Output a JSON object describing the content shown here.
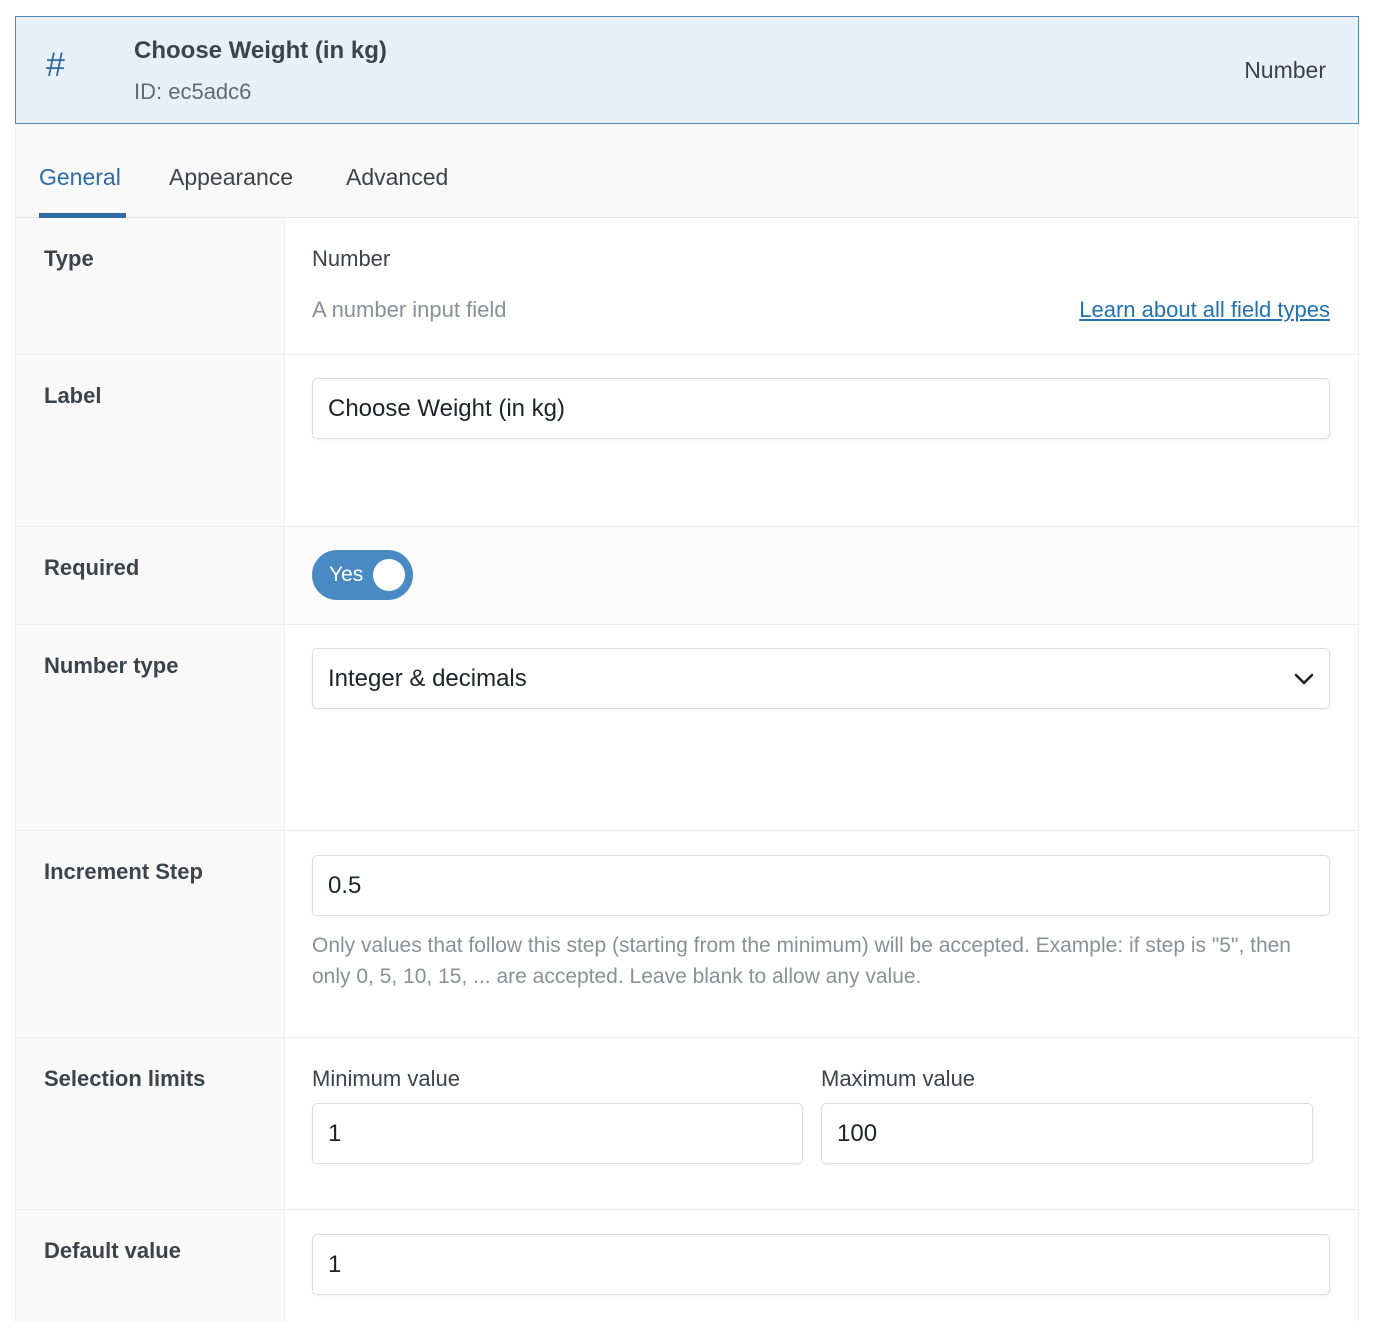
{
  "header": {
    "icon": "hash-icon",
    "icon_char": "#",
    "title": "Choose Weight (in kg)",
    "id_text": "ID: ec5adc6",
    "type_label": "Number"
  },
  "tabs": [
    {
      "label": "General",
      "active": true
    },
    {
      "label": "Appearance",
      "active": false
    },
    {
      "label": "Advanced",
      "active": false
    }
  ],
  "type_row": {
    "label": "Type",
    "value": "Number",
    "description": "A number input field",
    "link": "Learn about all field types"
  },
  "label_row": {
    "label": "Label",
    "value": "Choose Weight (in kg)"
  },
  "required_row": {
    "label": "Required",
    "toggle_text": "Yes",
    "on": true
  },
  "number_type_row": {
    "label": "Number type",
    "selected": "Integer & decimals"
  },
  "increment_row": {
    "label": "Increment Step",
    "value": "0.5",
    "help": "Only values that follow this step (starting from the minimum) will be accepted. Example: if step is \"5\", then only 0, 5, 10, 15, ... are accepted. Leave blank to allow any value."
  },
  "limits_row": {
    "label": "Selection limits",
    "min_label": "Minimum value",
    "min_value": "1",
    "max_label": "Maximum value",
    "max_value": "100"
  },
  "default_row": {
    "label": "Default value",
    "value": "1"
  },
  "colors": {
    "accent": "#2d6aa6",
    "toggle": "#4a8ac4",
    "header_bg": "#e7f0f8",
    "link": "#2271b1"
  }
}
